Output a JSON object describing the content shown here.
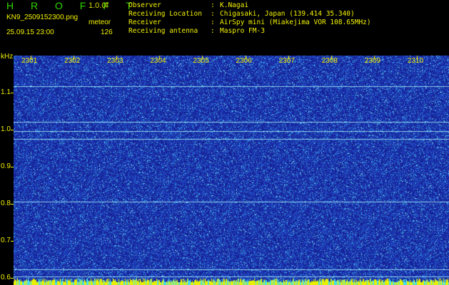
{
  "header": {
    "app_title": "H R O F F T",
    "version": "1.0.0f",
    "filename": "KN9_2509152300.png",
    "mode": "meteor",
    "datetime": "25.09.15 23:00",
    "count": "126"
  },
  "station_info": [
    {
      "key": "Observer",
      "sep": ":",
      "value": "K.Nagai"
    },
    {
      "key": "Receiving Location",
      "sep": ":",
      "value": "Chigasaki, Japan (139.414 35.340)"
    },
    {
      "key": "Receiver",
      "sep": ":",
      "value": "AirSpy mini (Miakejima VOR 108.65MHz)"
    },
    {
      "key": "Receiving antenna",
      "sep": ":",
      "value": "Maspro FM-3"
    }
  ],
  "chart_data": {
    "type": "heatmap",
    "ylabel": "kHz",
    "y_ticks": [
      "1.1",
      "1.0",
      "0.9",
      "0.8",
      "0.7",
      "0.6"
    ],
    "y_tick_values": [
      1.1,
      1.0,
      0.9,
      0.8,
      0.7,
      0.6
    ],
    "ylim": [
      0.58,
      1.2
    ],
    "x_ticks": [
      "2301",
      "2302",
      "2303",
      "2304",
      "2305",
      "2306",
      "2307",
      "2308",
      "2309",
      "2310"
    ],
    "x_tick_values": [
      2301,
      2302,
      2303,
      2304,
      2305,
      2306,
      2307,
      2308,
      2309,
      2310
    ],
    "xlim": [
      2300.6,
      2310.75
    ],
    "horizontal_lines_khz": [
      1.117,
      1.021,
      0.996,
      0.975,
      0.806,
      0.622,
      0.603
    ],
    "colors": {
      "background_noise": "#1a2a9a",
      "bright_line": "#9ff0ff",
      "foreground_text": "#f2f200",
      "title_green": "#2fd600"
    }
  }
}
